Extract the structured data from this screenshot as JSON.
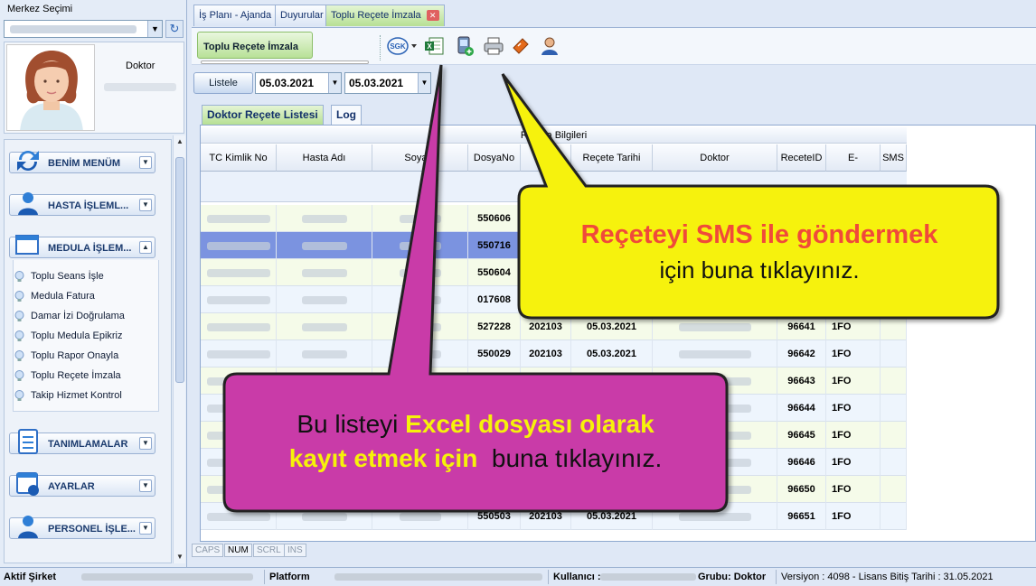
{
  "left": {
    "merkez_label": "Merkez Seçimi",
    "role": "Doktor",
    "menu": [
      {
        "label": "BENİM MENÜM"
      },
      {
        "label": "HASTA İŞLEML..."
      },
      {
        "label": "MEDULA İŞLEM..."
      },
      {
        "label": "TANIMLAMALAR"
      },
      {
        "label": "AYARLAR"
      },
      {
        "label": "PERSONEL İŞLE..."
      }
    ],
    "medula_items": [
      "Toplu Seans İşle",
      "Medula Fatura",
      "Damar İzi Doğrulama",
      "Toplu Medula Epikriz",
      "Toplu Rapor Onayla",
      "Toplu Reçete İmzala",
      "Takip Hizmet Kontrol"
    ]
  },
  "tabs": [
    {
      "label": "İş Planı - Ajanda"
    },
    {
      "label": "Duyurular"
    },
    {
      "label": "Toplu Reçete İmzala"
    }
  ],
  "toolbar": {
    "group_label": "Toplu Reçete İmzala",
    "sgk_icon_text": "SGK"
  },
  "filter": {
    "list_button": "Listele",
    "date_from": "05.03.2021",
    "date_to": "05.03.2021"
  },
  "subtabs": [
    "Doktor Reçete Listesi",
    "Log"
  ],
  "grid": {
    "group_header": "Reçeta Bilgileri",
    "columns": [
      "TC Kimlik No",
      "Hasta Adı",
      "Soyadı",
      "DosyaNo",
      "Sıra",
      "Reçete Tarihi",
      "Doktor",
      "ReceteID",
      "E-ReceteNo",
      "SMS"
    ],
    "rows": [
      {
        "dosya": "550606",
        "sira": "",
        "tarih": "",
        "recete": "",
        "ereceteno": ""
      },
      {
        "dosya": "550716",
        "sira": "",
        "tarih": "",
        "recete": "",
        "ereceteno": ""
      },
      {
        "dosya": "550604",
        "sira": "",
        "tarih": "",
        "recete": "",
        "ereceteno": ""
      },
      {
        "dosya": "017608",
        "sira": "",
        "tarih": "",
        "recete": "",
        "ereceteno": ""
      },
      {
        "dosya": "527228",
        "sira": "202103",
        "tarih": "05.03.2021",
        "recete": "96641",
        "ereceteno": "1FO"
      },
      {
        "dosya": "550029",
        "sira": "202103",
        "tarih": "05.03.2021",
        "recete": "96642",
        "ereceteno": "1FO"
      },
      {
        "dosya": "",
        "sira": "",
        "tarih": "",
        "recete": "96643",
        "ereceteno": "1FO"
      },
      {
        "dosya": "",
        "sira": "",
        "tarih": "",
        "recete": "96644",
        "ereceteno": "1FO"
      },
      {
        "dosya": "",
        "sira": "",
        "tarih": "",
        "recete": "96645",
        "ereceteno": "1FO"
      },
      {
        "dosya": "",
        "sira": "",
        "tarih": "",
        "recete": "96646",
        "ereceteno": "1FO"
      },
      {
        "dosya": "",
        "sira": "",
        "tarih": "",
        "recete": "96650",
        "ereceteno": "1FO"
      },
      {
        "dosya": "550503",
        "sira": "202103",
        "tarih": "05.03.2021",
        "recete": "96651",
        "ereceteno": "1FO"
      }
    ]
  },
  "keys": [
    "CAPS",
    "NUM",
    "SCRL",
    "INS"
  ],
  "bottom": {
    "company_label": "Aktif Şirket",
    "platform_label": "Platform",
    "user_label": "Kullanıcı :",
    "group_text": "Grubu: Doktor",
    "version_text": "Versiyon : 4098 - Lisans Bitiş Tarihi : 31.05.2021"
  },
  "callouts": {
    "sms_highlight": "Reçeteyi SMS ile göndermek",
    "sms_rest": "için buna tıklayınız.",
    "excel_line1_a": "Bu listeyi ",
    "excel_line1_b": "Excel dosyası olarak",
    "excel_line2_a": "kayıt etmek için",
    "excel_line2_b": "  buna tıklayınız."
  },
  "colors": {
    "sms_callout_fill": "#f6f20a",
    "excel_callout_fill": "#c93aa8",
    "sms_highlight_text": "#f04a3a",
    "excel_highlight_text": "#f6f20a",
    "active_tab": "#b7e094",
    "selected_row": "#7b93e0"
  },
  "icons": [
    "sgk-icon",
    "excel-export-icon",
    "sms-phone-icon",
    "print-icon",
    "ticket-icon",
    "user-icon"
  ]
}
